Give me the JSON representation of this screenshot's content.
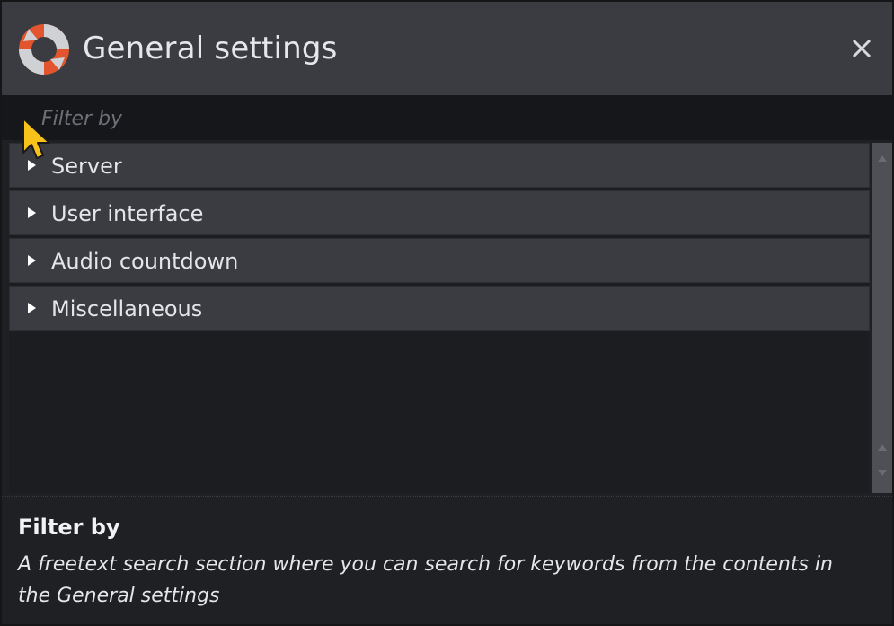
{
  "window": {
    "title": "General settings",
    "logo_icon": "app-logo-icon",
    "close_icon": "close-icon"
  },
  "filter": {
    "placeholder": "Filter by",
    "value": ""
  },
  "sections": [
    {
      "label": "Server",
      "icon": "triangle-right-icon"
    },
    {
      "label": "User interface",
      "icon": "triangle-right-icon"
    },
    {
      "label": "Audio countdown",
      "icon": "triangle-right-icon"
    },
    {
      "label": "Miscellaneous",
      "icon": "triangle-right-icon"
    }
  ],
  "help": {
    "title": "Filter by",
    "description": "A freetext search section where you can search for keywords from the contents in the General settings"
  },
  "colors": {
    "logo_orange": "#e2552e",
    "logo_gray": "#cfd1d4",
    "cursor_yellow": "#f7c21a"
  }
}
